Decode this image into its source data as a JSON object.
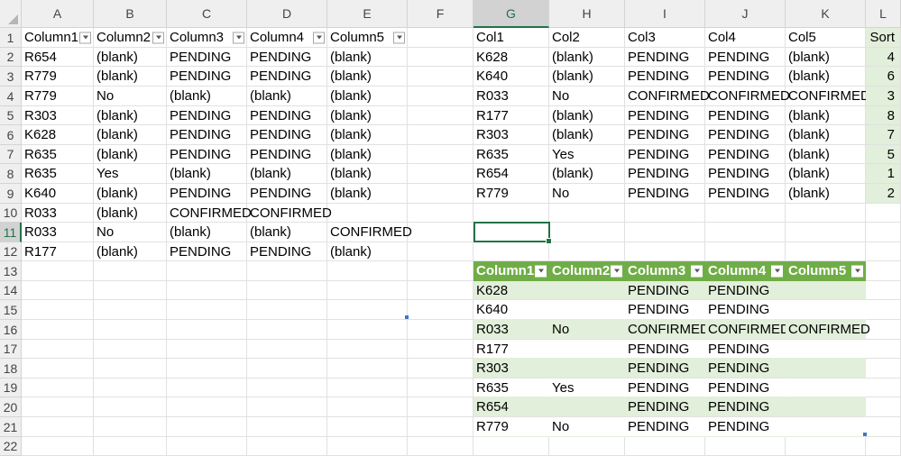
{
  "columns": [
    "A",
    "B",
    "C",
    "D",
    "E",
    "F",
    "G",
    "H",
    "I",
    "J",
    "K",
    "L"
  ],
  "rows": [
    "1",
    "2",
    "3",
    "4",
    "5",
    "6",
    "7",
    "8",
    "9",
    "10",
    "11",
    "12",
    "13",
    "14",
    "15",
    "16",
    "17",
    "18",
    "19",
    "20",
    "21",
    "22"
  ],
  "selection": {
    "column": "G",
    "row": "11"
  },
  "table1": {
    "headers": [
      "Column1",
      "Column2",
      "Column3",
      "Column4",
      "Column5"
    ],
    "rows": [
      [
        "R654",
        "(blank)",
        "PENDING",
        "PENDING",
        "(blank)"
      ],
      [
        "R779",
        "(blank)",
        "PENDING",
        "PENDING",
        "(blank)"
      ],
      [
        "R779",
        "No",
        "(blank)",
        "(blank)",
        "(blank)"
      ],
      [
        "R303",
        "(blank)",
        "PENDING",
        "PENDING",
        "(blank)"
      ],
      [
        "K628",
        "(blank)",
        "PENDING",
        "PENDING",
        "(blank)"
      ],
      [
        "R635",
        "(blank)",
        "PENDING",
        "PENDING",
        "(blank)"
      ],
      [
        "R635",
        "Yes",
        "(blank)",
        "(blank)",
        "(blank)"
      ],
      [
        "K640",
        "(blank)",
        "PENDING",
        "PENDING",
        "(blank)"
      ],
      [
        "R033",
        "(blank)",
        "CONFIRMED",
        "CONFIRMED",
        ""
      ],
      [
        "R033",
        "No",
        "(blank)",
        "(blank)",
        "CONFIRMED"
      ],
      [
        "R177",
        "(blank)",
        "PENDING",
        "PENDING",
        "(blank)"
      ]
    ]
  },
  "table2": {
    "headers": [
      "Col1",
      "Col2",
      "Col3",
      "Col4",
      "Col5",
      "Sort"
    ],
    "rows": [
      [
        "K628",
        "(blank)",
        "PENDING",
        "PENDING",
        "(blank)",
        "4"
      ],
      [
        "K640",
        "(blank)",
        "PENDING",
        "PENDING",
        "(blank)",
        "6"
      ],
      [
        "R033",
        "No",
        "CONFIRMED",
        "CONFIRMED",
        "CONFIRMED",
        "3"
      ],
      [
        "R177",
        "(blank)",
        "PENDING",
        "PENDING",
        "(blank)",
        "8"
      ],
      [
        "R303",
        "(blank)",
        "PENDING",
        "PENDING",
        "(blank)",
        "7"
      ],
      [
        "R635",
        "Yes",
        "PENDING",
        "PENDING",
        "(blank)",
        "5"
      ],
      [
        "R654",
        "(blank)",
        "PENDING",
        "PENDING",
        "(blank)",
        "1"
      ],
      [
        "R779",
        "No",
        "PENDING",
        "PENDING",
        "(blank)",
        "2"
      ]
    ]
  },
  "table3": {
    "headers": [
      "Column1",
      "Column2",
      "Column3",
      "Column4",
      "Column5"
    ],
    "rows": [
      [
        "K628",
        "",
        "PENDING",
        "PENDING",
        ""
      ],
      [
        "K640",
        "",
        "PENDING",
        "PENDING",
        ""
      ],
      [
        "R033",
        "No",
        "CONFIRMED",
        "CONFIRMED",
        "CONFIRMED"
      ],
      [
        "R177",
        "",
        "PENDING",
        "PENDING",
        ""
      ],
      [
        "R303",
        "",
        "PENDING",
        "PENDING",
        ""
      ],
      [
        "R635",
        "Yes",
        "PENDING",
        "PENDING",
        ""
      ],
      [
        "R654",
        "",
        "PENDING",
        "PENDING",
        ""
      ],
      [
        "R779",
        "No",
        "PENDING",
        "PENDING",
        ""
      ]
    ]
  },
  "colors": {
    "header_bg": "#efefef",
    "selected_accent": "#217346",
    "table_header": "#70ad47",
    "table_band": "#e2efda",
    "sort_col_bg": "#e2efda"
  },
  "icons": {
    "filter_dropdown": "chevron-down-icon"
  }
}
